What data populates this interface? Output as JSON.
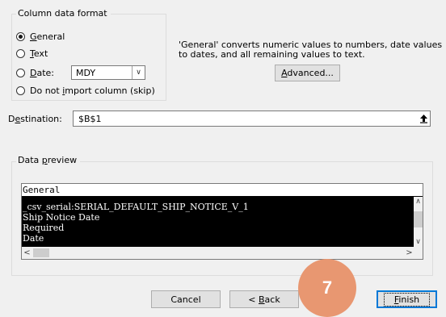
{
  "column_format": {
    "legend": "Column data format",
    "options": [
      {
        "label": "General",
        "checked": true
      },
      {
        "label": "Text",
        "checked": false
      },
      {
        "label": "Date:",
        "checked": false
      },
      {
        "label": "Do not import column (skip)",
        "checked": false
      }
    ],
    "date_format": "MDY",
    "description": "'General' converts numeric values to numbers, date values to dates, and all remaining values to text.",
    "advanced_label": "Advanced..."
  },
  "destination": {
    "label": "Destination:",
    "value": "$B$1"
  },
  "preview": {
    "legend": "Data preview",
    "header": "General",
    "rows": [
      "_csv_serial:SERIAL_DEFAULT_SHIP_NOTICE_V_1",
      "Ship Notice Date",
      "Required",
      "Date"
    ]
  },
  "buttons": {
    "cancel": "Cancel",
    "back": "< Back",
    "finish": "Finish"
  },
  "step_badge": "7",
  "colors": {
    "badge": "#e89771",
    "preview_background": "#000000",
    "default_button_border": "#0078d7"
  }
}
